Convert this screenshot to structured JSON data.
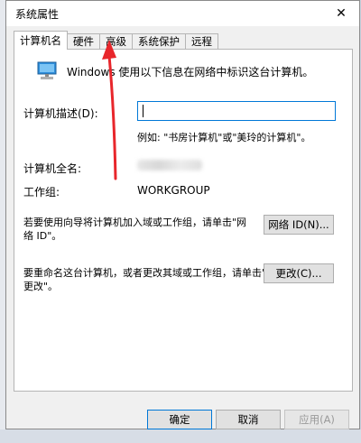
{
  "window": {
    "title": "系统属性",
    "close_glyph": "✕"
  },
  "tabs": [
    "计算机名",
    "硬件",
    "高级",
    "系统保护",
    "远程"
  ],
  "computer_name_tab": {
    "intro": "Windows 使用以下信息在网络中标识这台计算机。",
    "desc_label": "计算机描述(D):",
    "desc_value": "",
    "desc_hint": "例如: \"书房计算机\"或\"美玲的计算机\"。",
    "fullname_label": "计算机全名:",
    "workgroup_label": "工作组:",
    "workgroup_value": "WORKGROUP",
    "network_text_1": "若要使用向导将计算机加入域或工作组，请单击\"网",
    "network_text_2": "络 ID\"。",
    "network_button": "网络 ID(N)...",
    "rename_text_1": "要重命名这台计算机，或者更改其域或工作组，请单击\"",
    "rename_text_2": "更改\"。",
    "change_button": "更改(C)..."
  },
  "footer": {
    "ok": "确定",
    "cancel": "取消",
    "apply": "应用(A)"
  },
  "colors": {
    "annotation_arrow": "#e8262b",
    "focus_border": "#0078d7"
  }
}
